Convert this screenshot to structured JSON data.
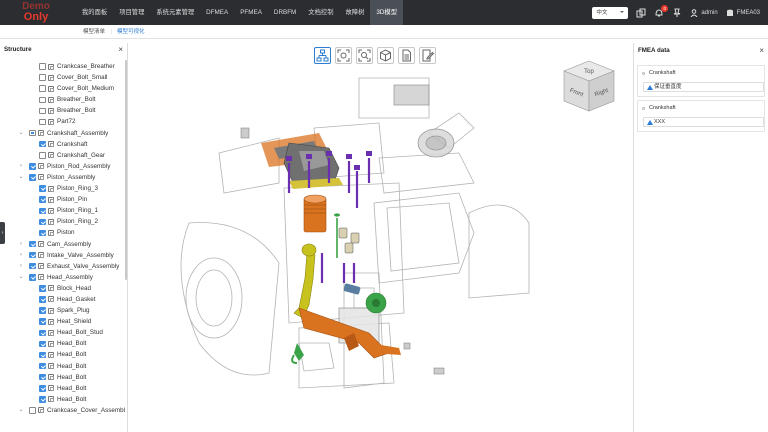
{
  "logo": {
    "line1": "Demo",
    "line2": "Only"
  },
  "nav": [
    {
      "label": "我的面板"
    },
    {
      "label": "项目管理"
    },
    {
      "label": "系统元素管理"
    },
    {
      "label": "DFMEA"
    },
    {
      "label": "PFMEA"
    },
    {
      "label": "DRBFM"
    },
    {
      "label": "文档控制"
    },
    {
      "label": "故障树"
    },
    {
      "label": "3D模型"
    }
  ],
  "nav_active": "3D模型",
  "topright": {
    "language": "中文",
    "notification_count": "0",
    "user": "admin",
    "project": "FMEA03"
  },
  "subtabs": [
    {
      "label": "模型清单"
    },
    {
      "label": "模型可视化"
    }
  ],
  "subtab_active": "模型可视化",
  "structure": {
    "title": "Structure",
    "close": "×",
    "rows": [
      {
        "label": "Crankcase_Breather",
        "level": 2,
        "checked": false,
        "toggle": ""
      },
      {
        "label": "Cover_Bolt_Small",
        "level": 2,
        "checked": false,
        "toggle": ""
      },
      {
        "label": "Cover_Bolt_Medium",
        "level": 2,
        "checked": false,
        "toggle": ""
      },
      {
        "label": "Breather_Bolt",
        "level": 2,
        "checked": false,
        "toggle": ""
      },
      {
        "label": "Breather_Bolt",
        "level": 2,
        "checked": false,
        "toggle": ""
      },
      {
        "label": "Part72",
        "level": 2,
        "checked": false,
        "toggle": ""
      },
      {
        "label": "Crankshaft_Assembly",
        "level": 1,
        "checked": "partial",
        "toggle": "⌄"
      },
      {
        "label": "Crankshaft",
        "level": 2,
        "checked": true,
        "toggle": ""
      },
      {
        "label": "Crankshaft_Gear",
        "level": 2,
        "checked": false,
        "toggle": ""
      },
      {
        "label": "Piston_Rod_Assembly",
        "level": 1,
        "checked": true,
        "toggle": "›"
      },
      {
        "label": "Piston_Assembly",
        "level": 1,
        "checked": true,
        "toggle": "⌄"
      },
      {
        "label": "Piston_Ring_3",
        "level": 2,
        "checked": true,
        "toggle": ""
      },
      {
        "label": "Piston_Pin",
        "level": 2,
        "checked": true,
        "toggle": ""
      },
      {
        "label": "Piston_Ring_1",
        "level": 2,
        "checked": true,
        "toggle": ""
      },
      {
        "label": "Piston_Ring_2",
        "level": 2,
        "checked": true,
        "toggle": ""
      },
      {
        "label": "Piston",
        "level": 2,
        "checked": true,
        "toggle": ""
      },
      {
        "label": "Cam_Assembly",
        "level": 1,
        "checked": true,
        "toggle": "›"
      },
      {
        "label": "Intake_Valve_Assembly",
        "level": 1,
        "checked": true,
        "toggle": "›"
      },
      {
        "label": "Exhaust_Valve_Assembly",
        "level": 1,
        "checked": true,
        "toggle": "›"
      },
      {
        "label": "Head_Assembly",
        "level": 1,
        "checked": true,
        "toggle": "⌄"
      },
      {
        "label": "Block_Head",
        "level": 2,
        "checked": true,
        "toggle": ""
      },
      {
        "label": "Head_Gasket",
        "level": 2,
        "checked": true,
        "toggle": ""
      },
      {
        "label": "Spark_Plug",
        "level": 2,
        "checked": true,
        "toggle": ""
      },
      {
        "label": "Heat_Shield",
        "level": 2,
        "checked": true,
        "toggle": ""
      },
      {
        "label": "Head_Bolt_Stud",
        "level": 2,
        "checked": true,
        "toggle": ""
      },
      {
        "label": "Head_Bolt",
        "level": 2,
        "checked": true,
        "toggle": ""
      },
      {
        "label": "Head_Bolt",
        "level": 2,
        "checked": true,
        "toggle": ""
      },
      {
        "label": "Head_Bolt",
        "level": 2,
        "checked": true,
        "toggle": ""
      },
      {
        "label": "Head_Bolt",
        "level": 2,
        "checked": true,
        "toggle": ""
      },
      {
        "label": "Head_Bolt",
        "level": 2,
        "checked": true,
        "toggle": ""
      },
      {
        "label": "Head_Bolt",
        "level": 2,
        "checked": true,
        "toggle": ""
      },
      {
        "label": "Crankcase_Cover_Assembl",
        "level": 1,
        "checked": false,
        "toggle": "⌄"
      }
    ]
  },
  "toolbar": {
    "buttons": [
      "structure-tree",
      "fit-view",
      "zoom-box",
      "explode-view",
      "document",
      "edit-note"
    ]
  },
  "viewcube": {
    "top": "Top",
    "front": "Front",
    "right": "Right"
  },
  "fmea": {
    "title": "FMEA data",
    "close": "×",
    "cards": [
      {
        "name": "Crankshaft",
        "value": "保证垂直度"
      },
      {
        "name": "Crankshaft",
        "value": "XXX"
      }
    ]
  },
  "colors": {
    "accent": "#2b7cd3",
    "topbar": "#2b2d31",
    "logo_red": "#e8392d",
    "crankshaft": "#d9731f",
    "bolts": "#6a2fb0",
    "connecting_rod": "#c8c21e",
    "gear": "#3aa348"
  }
}
